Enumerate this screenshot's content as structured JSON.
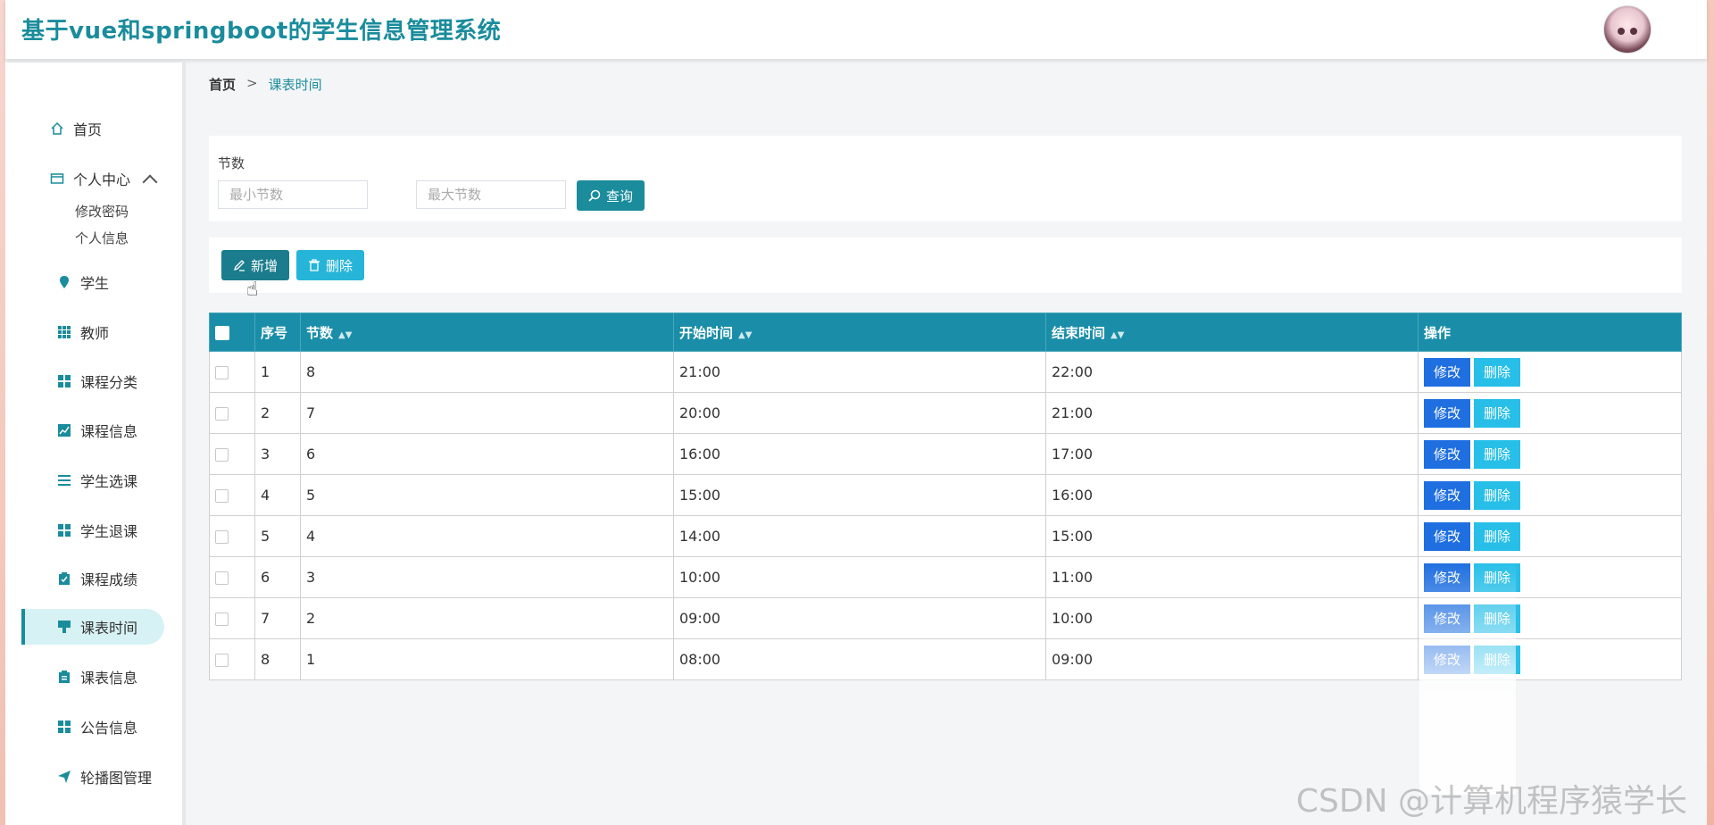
{
  "app": {
    "title": "基于vue和springboot的学生信息管理系统"
  },
  "sidebar": {
    "items": [
      {
        "label": "首页",
        "icon": "home-icon"
      },
      {
        "label": "个人中心",
        "icon": "wallet-icon"
      },
      {
        "label": "学生",
        "icon": "pin-icon"
      },
      {
        "label": "教师",
        "icon": "grid-icon"
      },
      {
        "label": "课程分类",
        "icon": "grid-icon"
      },
      {
        "label": "课程信息",
        "icon": "chart-icon"
      },
      {
        "label": "学生选课",
        "icon": "list-icon"
      },
      {
        "label": "学生退课",
        "icon": "grid-icon"
      },
      {
        "label": "课程成绩",
        "icon": "clipboard-icon"
      },
      {
        "label": "课表时间",
        "icon": "stamp-icon"
      },
      {
        "label": "课表信息",
        "icon": "document-icon"
      },
      {
        "label": "公告信息",
        "icon": "grid-icon"
      },
      {
        "label": "轮播图管理",
        "icon": "send-icon"
      }
    ],
    "submenu": [
      "修改密码",
      "个人信息"
    ],
    "active": "课表时间"
  },
  "breadcrumb": {
    "home": "首页",
    "separator": ">",
    "current": "课表时间"
  },
  "search": {
    "label": "节数",
    "min_placeholder": "最小节数",
    "max_placeholder": "最大节数",
    "button": "查询"
  },
  "actions": {
    "add": "新增",
    "delete": "删除"
  },
  "table": {
    "headers": [
      "序号",
      "节数",
      "开始时间",
      "结束时间",
      "操作"
    ],
    "rows": [
      {
        "no": "1",
        "section": "8",
        "start": "21:00",
        "end": "22:00"
      },
      {
        "no": "2",
        "section": "7",
        "start": "20:00",
        "end": "21:00"
      },
      {
        "no": "3",
        "section": "6",
        "start": "16:00",
        "end": "17:00"
      },
      {
        "no": "4",
        "section": "5",
        "start": "15:00",
        "end": "16:00"
      },
      {
        "no": "5",
        "section": "4",
        "start": "14:00",
        "end": "15:00"
      },
      {
        "no": "6",
        "section": "3",
        "start": "10:00",
        "end": "11:00"
      },
      {
        "no": "7",
        "section": "2",
        "start": "09:00",
        "end": "10:00"
      },
      {
        "no": "8",
        "section": "1",
        "start": "08:00",
        "end": "09:00"
      }
    ],
    "row_actions": {
      "edit": "修改",
      "delete": "删除"
    }
  },
  "watermark": "CSDN @计算机程序猿学长",
  "colors": {
    "accent": "#1a8c9c",
    "table_header": "#1a8ea8",
    "edit_button": "#1f6fe0",
    "delete_button": "#27bfe8"
  }
}
